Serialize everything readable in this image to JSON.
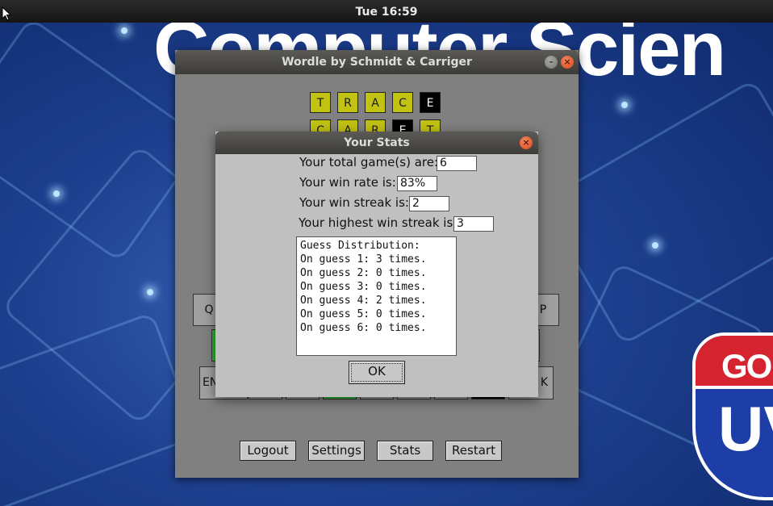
{
  "topbar": {
    "clock": "Tue 16:59"
  },
  "background": {
    "banner_text": "Computer Scien",
    "logo_top": "GO",
    "logo_bottom": "UV"
  },
  "window": {
    "title": "Wordle by Schmidt & Carriger",
    "grid": [
      {
        "letters": [
          "T",
          "R",
          "A",
          "C",
          "E"
        ],
        "colors": [
          "yellow",
          "yellow",
          "yellow",
          "yellow",
          "black"
        ]
      },
      {
        "letters": [
          "C",
          "A",
          "R",
          "E",
          "T"
        ],
        "colors": [
          "yellow",
          "yellow",
          "yellow",
          "black",
          "yellow"
        ]
      }
    ],
    "keyboard": {
      "row1_first": "Q",
      "row1_last": "P",
      "row3_first": "EN",
      "row3_last": "K"
    },
    "buttons": {
      "logout": "Logout",
      "settings": "Settings",
      "stats": "Stats",
      "restart": "Restart"
    }
  },
  "dialog": {
    "title": "Your Stats",
    "total_games_label": "Your total game(s) are:",
    "total_games_value": "6",
    "win_rate_label": "Your win rate is:",
    "win_rate_value": "83%",
    "win_streak_label": "Your win streak is:",
    "win_streak_value": "2",
    "highest_streak_label": "Your highest win streak is:",
    "highest_streak_value": "3",
    "distribution": [
      "Guess Distribution:",
      "On guess 1: 3 times.",
      "On guess 2: 0 times.",
      "On guess 3: 0 times.",
      "On guess 4: 2 times.",
      "On guess 5: 0 times.",
      "On guess 6: 0 times."
    ],
    "ok_label": "OK"
  }
}
